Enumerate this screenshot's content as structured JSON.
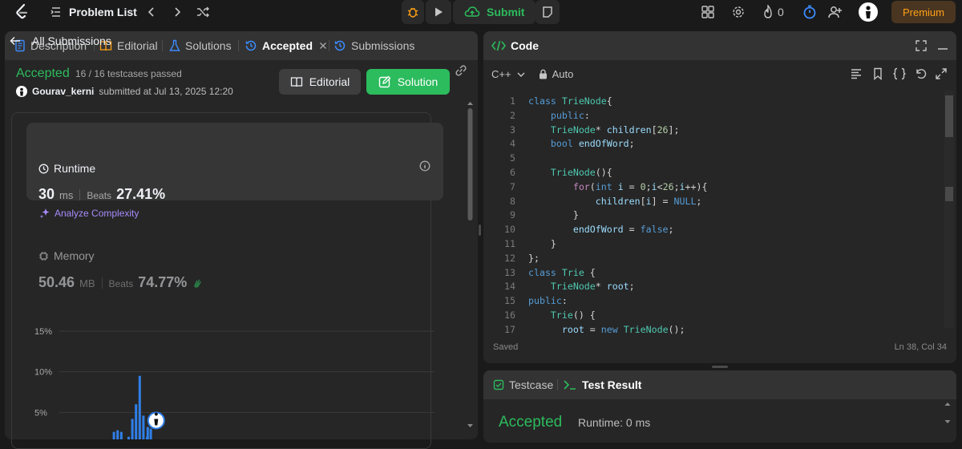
{
  "nav": {
    "problem_list": "Problem List",
    "submit": "Submit",
    "streak": "0",
    "premium": "Premium"
  },
  "left_tabs": [
    {
      "label": "Description"
    },
    {
      "label": "Editorial"
    },
    {
      "label": "Solutions"
    },
    {
      "label": "Accepted"
    },
    {
      "label": "Submissions"
    }
  ],
  "submission": {
    "back_label": "All Submissions",
    "status": "Accepted",
    "testcases": "16 / 16 testcases passed",
    "user": "Gourav_kerni",
    "submitted_text": "submitted at Jul 13, 2025 12:20",
    "editorial_btn": "Editorial",
    "solution_btn": "Solution"
  },
  "runtime": {
    "label": "Runtime",
    "value": "30",
    "unit": "ms",
    "beats_label": "Beats",
    "beats": "27.41%",
    "analyze": "Analyze Complexity"
  },
  "memory": {
    "label": "Memory",
    "value": "50.46",
    "unit": "MB",
    "beats_label": "Beats",
    "beats": "74.77%"
  },
  "chart_data": {
    "type": "bar",
    "y_ticks": [
      "15%",
      "10%",
      "5%"
    ],
    "ylim": [
      0,
      15
    ],
    "values": [
      0.6,
      2.6,
      2.8,
      2.6,
      0.8,
      2.0,
      4.2,
      6.0,
      9.5,
      4.6,
      2.0,
      3.0,
      1.2,
      3.2
    ],
    "highlight_index": 13
  },
  "code": {
    "title": "Code",
    "language": "C++",
    "mode": "Auto",
    "footer_left": "Saved",
    "footer_right": "Ln 38, Col 34",
    "lines": [
      "class TrieNode{",
      "    public:",
      "    TrieNode* children[26];",
      "    bool endOfWord;",
      "",
      "    TrieNode(){",
      "        for(int i = 0;i<26;i++){",
      "            children[i] = NULL;",
      "        }",
      "        endOfWord = false;",
      "    }",
      "};",
      "class Trie {",
      "    TrieNode* root;",
      "public:",
      "    Trie() {",
      "      root = new TrieNode();"
    ]
  },
  "test": {
    "testcase_tab": "Testcase",
    "result_tab": "Test Result",
    "status": "Accepted",
    "runtime": "Runtime: 0 ms"
  },
  "colors": {
    "accent_green": "#2cbb5d",
    "premium": "#ffa116",
    "bar_blue": "#2f7fe8",
    "active_tab_blue": "#3c8cff"
  }
}
